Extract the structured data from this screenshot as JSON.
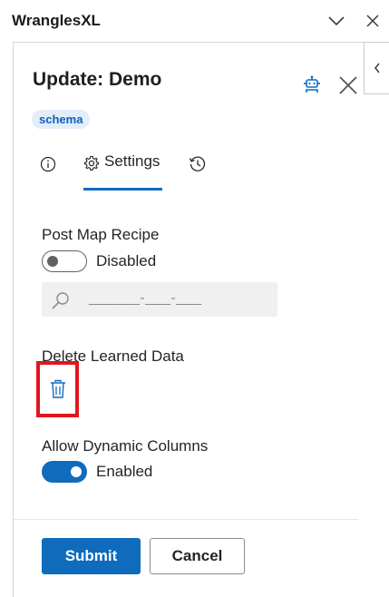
{
  "app": {
    "title": "WranglesXL"
  },
  "titlebar": {
    "collapse_icon": "chevron-down-icon",
    "close_icon": "close-icon"
  },
  "panel": {
    "title": "Update: Demo",
    "badge": "schema",
    "actions": {
      "robot_icon": "robot-icon",
      "close_icon": "close-icon"
    }
  },
  "tabs": [
    {
      "id": "info",
      "label": "",
      "icon": "info-icon",
      "selected": false
    },
    {
      "id": "settings",
      "label": "Settings",
      "icon": "gear-icon",
      "selected": true
    },
    {
      "id": "history",
      "label": "",
      "icon": "history-icon",
      "selected": false
    }
  ],
  "settings": {
    "post_map_recipe": {
      "label": "Post Map Recipe",
      "toggle_state": "Disabled",
      "enabled": false,
      "search_placeholder": "______-___-___"
    },
    "delete_learned_data": {
      "label": "Delete Learned Data",
      "icon": "trash-icon"
    },
    "allow_dynamic_columns": {
      "label": "Allow Dynamic Columns",
      "toggle_state": "Enabled",
      "enabled": true
    }
  },
  "footer": {
    "submit_label": "Submit",
    "cancel_label": "Cancel"
  },
  "colors": {
    "accent": "#0f6cbd",
    "badge_bg": "#e4eefb",
    "highlight": "#e0161e"
  }
}
